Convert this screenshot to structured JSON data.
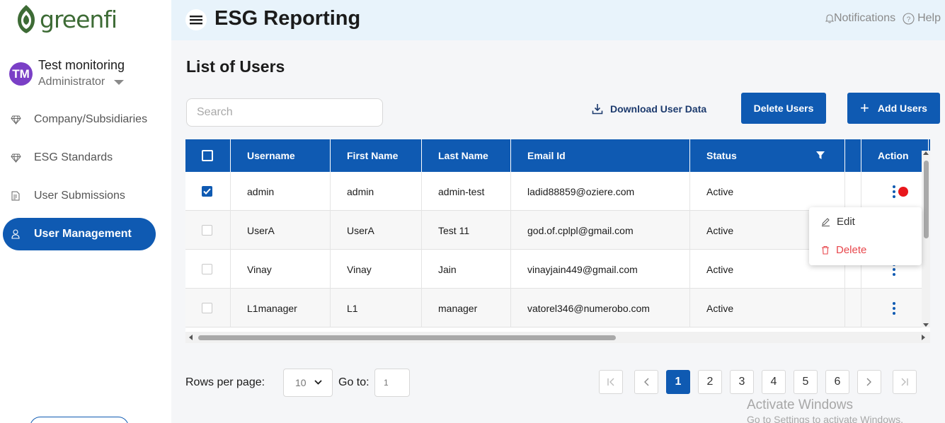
{
  "brand": {
    "name": "greenfi",
    "color": "#3d6b35"
  },
  "profile": {
    "initials": "TM",
    "name": "Test monitoring",
    "role": "Administrator"
  },
  "sidebar": {
    "items": [
      {
        "label": "Company/Subsidiaries",
        "icon": "diamond-icon",
        "active": false
      },
      {
        "label": "ESG Standards",
        "icon": "diamond-icon",
        "active": false
      },
      {
        "label": "User Submissions",
        "icon": "document-icon",
        "active": false
      },
      {
        "label": "User Management",
        "icon": "user-icon",
        "active": true
      }
    ]
  },
  "header": {
    "title": "ESG Reporting",
    "notifications_label": "Notifications",
    "help_label": "Help"
  },
  "main": {
    "title": "List of Users",
    "search_placeholder": "Search",
    "download_label": "Download User Data",
    "delete_label": "Delete Users",
    "add_label": "Add Users"
  },
  "table": {
    "columns": [
      "Username",
      "First Name",
      "Last Name",
      "Email Id",
      "Status",
      "Action"
    ],
    "rows": [
      {
        "checked": true,
        "username": "admin",
        "first_name": "admin",
        "last_name": "admin-test",
        "email": "ladid88859@oziere.com",
        "status": "Active"
      },
      {
        "checked": false,
        "username": "UserA",
        "first_name": "UserA",
        "last_name": "Test 11",
        "email": "god.of.cplpl@gmail.com",
        "status": "Active"
      },
      {
        "checked": false,
        "username": "Vinay",
        "first_name": "Vinay",
        "last_name": "Jain",
        "email": "vinayjain449@gmail.com",
        "status": "Active"
      },
      {
        "checked": false,
        "username": "L1manager",
        "first_name": "L1",
        "last_name": "manager",
        "email": "vatorel346@numerobo.com",
        "status": "Active"
      }
    ]
  },
  "action_menu": {
    "edit_label": "Edit",
    "delete_label": "Delete"
  },
  "pagination": {
    "rows_per_page_label": "Rows per page:",
    "rows_per_page_value": "10",
    "goto_label": "Go to:",
    "goto_placeholder": "1",
    "pages": [
      "1",
      "2",
      "3",
      "4",
      "5",
      "6"
    ],
    "current_page": "1"
  },
  "watermark": {
    "line1": "Activate Windows",
    "line2": "Go to Settings to activate Windows."
  },
  "colors": {
    "primary": "#0f5ab2",
    "header_bg": "#e8f3fb",
    "danger": "#e8474c",
    "alert_dot": "#e8171c"
  }
}
